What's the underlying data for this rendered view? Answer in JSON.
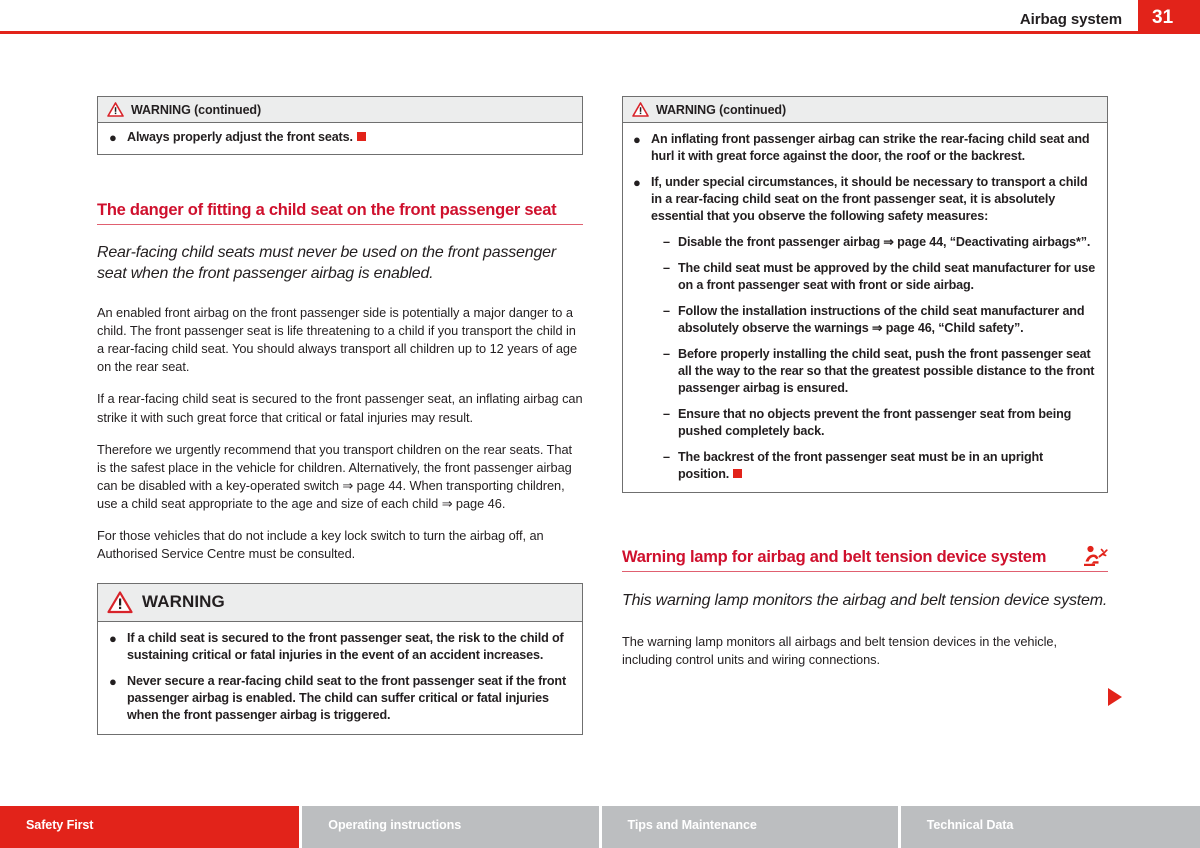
{
  "header": {
    "title": "Airbag system",
    "page_number": "31",
    "accent_color": "#e2231a"
  },
  "left_column": {
    "warning_continued": {
      "label": "WARNING (continued)",
      "icon": "warning-triangle-icon",
      "items": [
        {
          "marker": "●",
          "text": "Always properly adjust the front seats.",
          "end_square": true
        }
      ]
    },
    "section": {
      "heading": "The danger of fitting a child seat on the front passenger seat",
      "lead": "Rear-facing child seats must never be used on the front passenger seat when the front passenger airbag is enabled.",
      "paragraphs": [
        "An enabled front airbag on the front passenger side is potentially a major danger to a child. The front passenger seat is life threatening to a child if you transport the child in a rear-facing child seat. You should always transport all children up to 12 years of age on the rear seat.",
        "If a rear-facing child seat is secured to the front passenger seat, an inflating airbag can strike it with such great force that critical or fatal injuries may result.",
        "Therefore we urgently recommend that you transport children on the rear seats. That is the safest place in the vehicle for children. Alternatively, the front passenger airbag can be disabled with a key-operated switch ⇒ page 44. When transporting children, use a child seat appropriate to the age and size of each child ⇒ page 46.",
        "For those vehicles that do not include a key lock switch to turn the airbag off, an Authorised Service Centre must be consulted."
      ]
    },
    "warning_box": {
      "label": "WARNING",
      "icon": "warning-triangle-icon",
      "items": [
        {
          "marker": "●",
          "text": "If a child seat is secured to the front passenger seat, the risk to the child of sustaining critical or fatal injuries in the event of an accident increases.",
          "end_square": false
        },
        {
          "marker": "●",
          "text": "Never secure a rear-facing child seat to the front passenger seat if the front passenger airbag is enabled. The child can suffer critical or fatal injuries when the front passenger airbag is triggered.",
          "end_square": false
        }
      ]
    }
  },
  "right_column": {
    "warning_continued": {
      "label": "WARNING (continued)",
      "icon": "warning-triangle-icon",
      "items": [
        {
          "marker": "●",
          "indent": false,
          "text": "An inflating front passenger airbag can strike the rear-facing child seat and hurl it with great force against the door, the roof or the backrest.",
          "end_square": false
        },
        {
          "marker": "●",
          "indent": false,
          "text": "If, under special circumstances, it should be necessary to transport a child in a rear-facing child seat on the front passenger seat, it is absolutely essential that you observe the following safety measures:",
          "end_square": false
        },
        {
          "marker": "–",
          "indent": true,
          "text": "Disable the front passenger airbag ⇒ page 44, “Deactivating airbags*”.",
          "end_square": false
        },
        {
          "marker": "–",
          "indent": true,
          "text": "The child seat must be approved by the child seat manufacturer for use on a front passenger seat with front or side airbag.",
          "end_square": false
        },
        {
          "marker": "–",
          "indent": true,
          "text": "Follow the installation instructions of the child seat manufacturer and absolutely observe the warnings ⇒ page 46, “Child safety”.",
          "end_square": false
        },
        {
          "marker": "–",
          "indent": true,
          "text": "Before properly installing the child seat, push the front passenger seat all the way to the rear so that the greatest possible distance to the front passenger airbag is ensured.",
          "end_square": false
        },
        {
          "marker": "–",
          "indent": true,
          "text": "Ensure that no objects prevent the front passenger seat from being pushed completely back.",
          "end_square": false
        },
        {
          "marker": "–",
          "indent": true,
          "text": "The backrest of the front passenger seat must be in an upright position.",
          "end_square": true
        }
      ]
    },
    "section": {
      "heading": "Warning lamp for airbag and belt tension device system",
      "heading_icon": "airbag-warning-lamp-icon",
      "lead": "This warning lamp monitors the airbag and belt tension device system.",
      "paragraphs": [
        "The warning lamp monitors all airbags and belt tension devices in the vehicle, including control units and wiring connections."
      ]
    },
    "continuation_marker": "continuation-arrow-icon"
  },
  "footer": {
    "tabs": [
      {
        "label": "Safety First",
        "active": true
      },
      {
        "label": "Operating instructions",
        "active": false
      },
      {
        "label": "Tips and Maintenance",
        "active": false
      },
      {
        "label": "Technical Data",
        "active": false
      }
    ]
  }
}
